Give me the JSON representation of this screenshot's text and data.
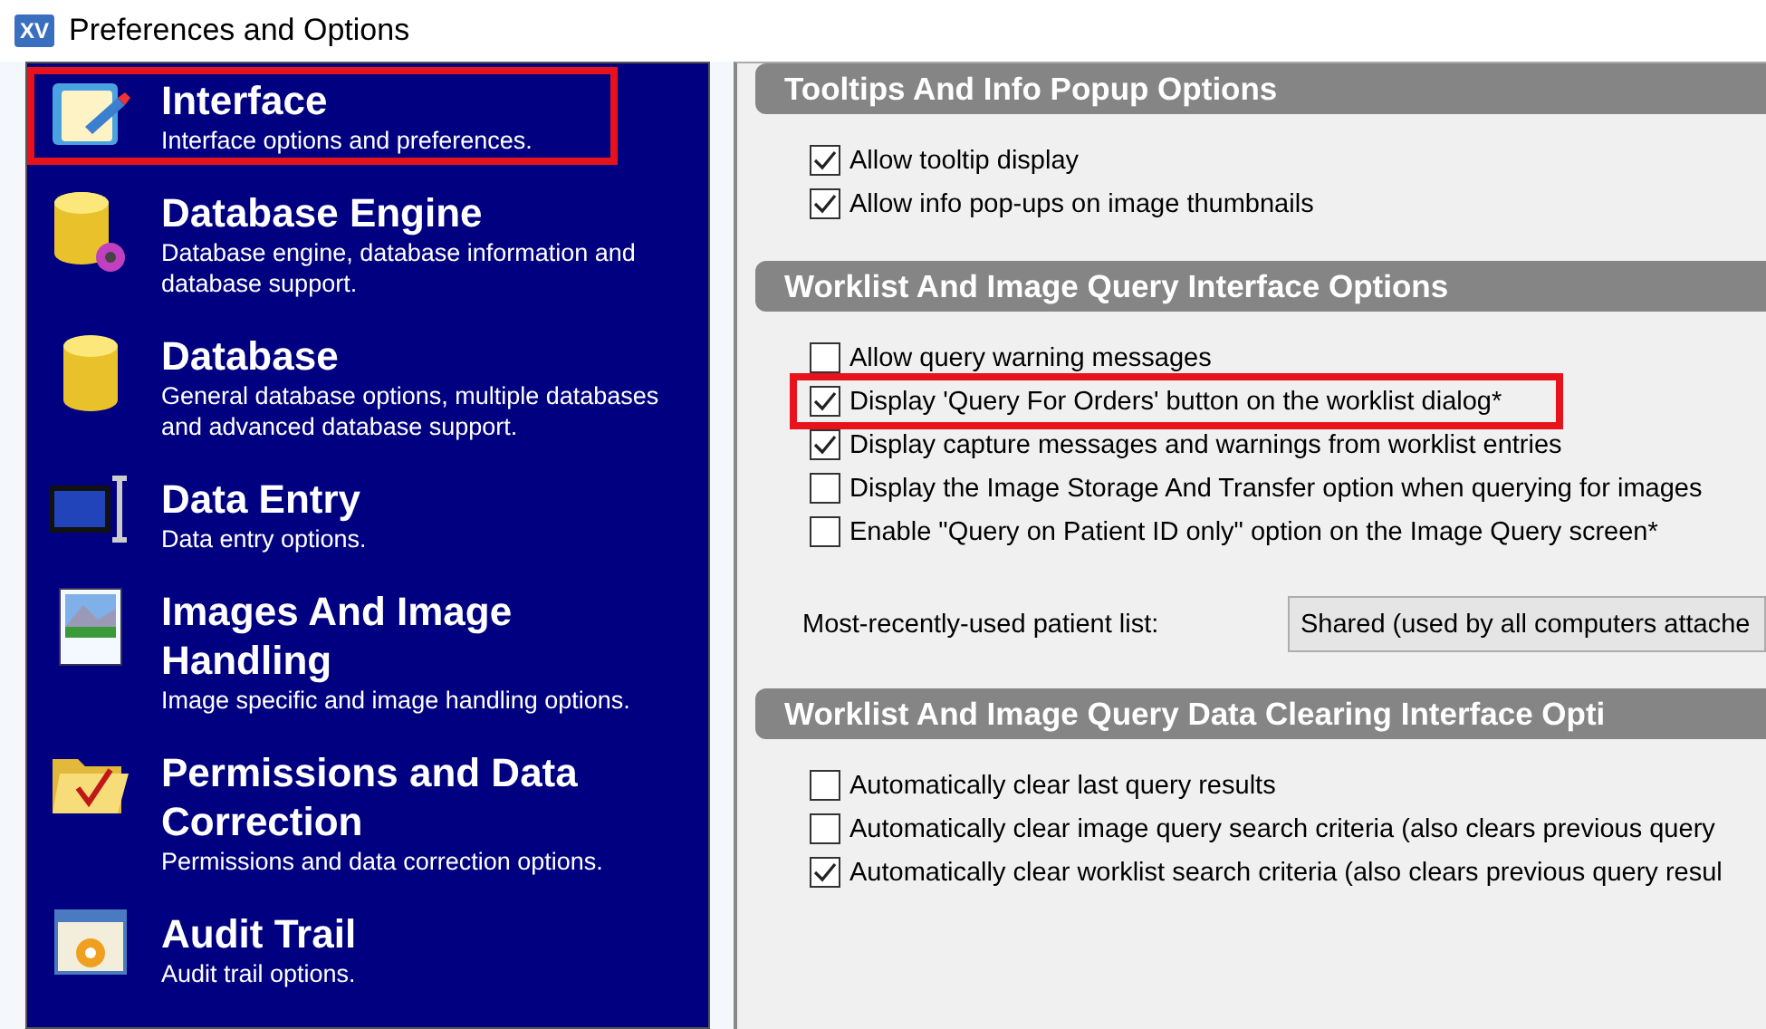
{
  "window": {
    "title": "Preferences and Options",
    "logo": "XV"
  },
  "sidebar": {
    "items": [
      {
        "title": "Interface",
        "description": "Interface options and preferences.",
        "selected": true
      },
      {
        "title": "Database Engine",
        "description": "Database engine, database information and database support.",
        "selected": false
      },
      {
        "title": "Database",
        "description": "General database options, multiple databases and advanced database support.",
        "selected": false
      },
      {
        "title": "Data Entry",
        "description": "Data entry options.",
        "selected": false
      },
      {
        "title": "Images And Image Handling",
        "description": "Image specific and image handling options.",
        "selected": false
      },
      {
        "title": "Permissions and Data Correction",
        "description": "Permissions and data correction options.",
        "selected": false
      },
      {
        "title": "Audit Trail",
        "description": "Audit trail options.",
        "selected": false
      }
    ]
  },
  "sections": [
    {
      "title": "Tooltips And Info Popup Options",
      "options": [
        {
          "label": "Allow tooltip display",
          "checked": true,
          "highlighted": false
        },
        {
          "label": "Allow info pop-ups on image thumbnails",
          "checked": true,
          "highlighted": false
        }
      ]
    },
    {
      "title": "Worklist And Image Query Interface Options",
      "options": [
        {
          "label": "Allow query warning messages",
          "checked": false,
          "highlighted": false
        },
        {
          "label": "Display 'Query For Orders' button on the worklist dialog*",
          "checked": true,
          "highlighted": true
        },
        {
          "label": "Display capture messages and warnings from worklist entries",
          "checked": true,
          "highlighted": false
        },
        {
          "label": "Display the Image Storage And Transfer option when querying for images",
          "checked": false,
          "highlighted": false
        },
        {
          "label": "Enable \"Query on Patient ID only\" option on the Image Query screen*",
          "checked": false,
          "highlighted": false
        }
      ],
      "dropdown": {
        "label": "Most-recently-used patient list:",
        "value": "Shared (used by all computers attache"
      }
    },
    {
      "title": "Worklist And Image Query Data Clearing Interface Opti",
      "options": [
        {
          "label": "Automatically clear last query results",
          "checked": false,
          "highlighted": false
        },
        {
          "label": "Automatically clear image query search criteria (also clears previous query",
          "checked": false,
          "highlighted": false
        },
        {
          "label": "Automatically clear worklist search criteria (also clears previous query resul",
          "checked": true,
          "highlighted": false
        }
      ]
    }
  ]
}
